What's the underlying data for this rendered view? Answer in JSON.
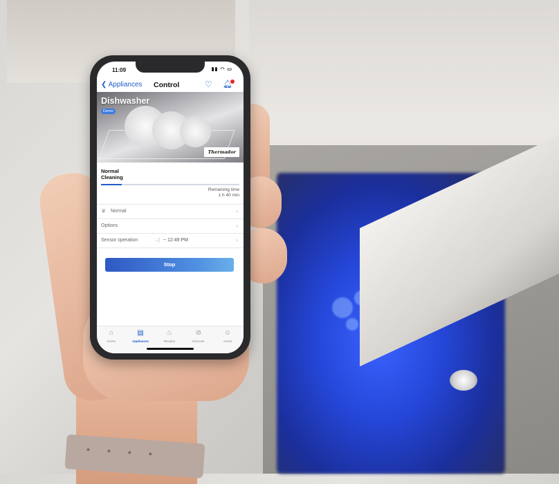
{
  "status_bar": {
    "time": "11:09"
  },
  "nav": {
    "back_label": "Appliances",
    "title": "Control"
  },
  "hero": {
    "title": "Dishwasher",
    "badge": "Demo",
    "brand": "Thermador"
  },
  "program": {
    "name": "Normal",
    "phase": "Cleaning",
    "progress": 0.15,
    "remaining_label": "Remaining time",
    "remaining_value": "1 h 40 min"
  },
  "settings": {
    "program_row": "Normal",
    "options_row": "Options",
    "sensor_row": "Sensor operation",
    "sensor_time": "~ 12:49 PM"
  },
  "stop_button": "Stop",
  "tabs": [
    {
      "label": "Home",
      "icon": "home-icon"
    },
    {
      "label": "Appliances",
      "icon": "appliances-icon",
      "active": true
    },
    {
      "label": "Recipes",
      "icon": "recipes-icon"
    },
    {
      "label": "Discover",
      "icon": "compass-icon"
    },
    {
      "label": "Assist",
      "icon": "assist-icon"
    }
  ],
  "colors": {
    "accent": "#1f5dc6",
    "stop_gradient_end": "#6ab0ea",
    "notification": "#e32b2b"
  }
}
